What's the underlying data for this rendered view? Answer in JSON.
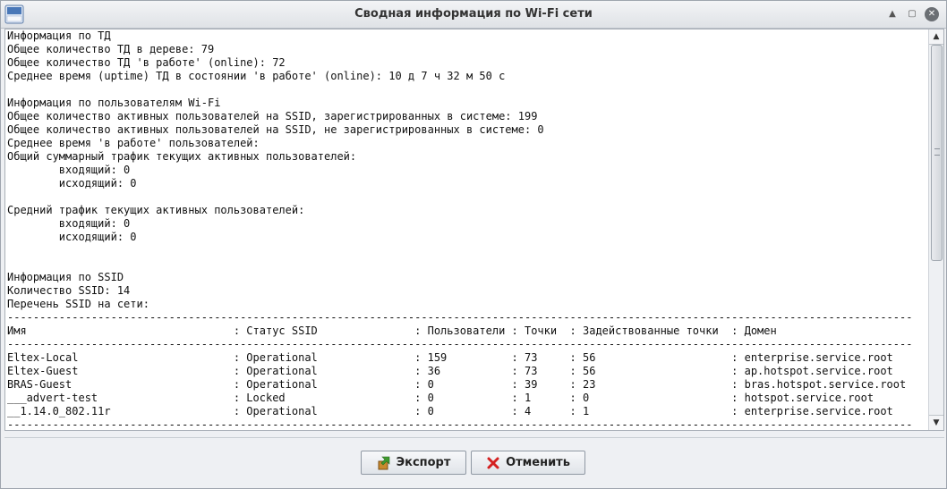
{
  "window": {
    "title": "Сводная информация по Wi-Fi сети"
  },
  "report": {
    "lines": [
      "Информация по ТД",
      "Общее количество ТД в дереве: 79",
      "Общее количество ТД 'в работе' (online): 72",
      "Среднее время (uptime) ТД в состоянии 'в работе' (online): 10 д 7 ч 32 м 50 с",
      "",
      "Информация по пользователям Wi-Fi",
      "Общее количество активных пользователей на SSID, зарегистрированных в системе: 199",
      "Общее количество активных пользователей на SSID, не зарегистрированных в системе: 0",
      "Среднее время 'в работе' пользователей:",
      "Общий суммарный трафик текущих активных пользователей:",
      "        входящий: 0",
      "        исходящий: 0",
      "",
      "Средний трафик текущих активных пользователей:",
      "        входящий: 0",
      "        исходящий: 0",
      "",
      "",
      "Информация по SSID",
      "Количество SSID: 14",
      "Перечень SSID на сети:",
      "--------------------------------------------------------------------------------------------------------------------------------------------",
      "Имя                                : Статус SSID               : Пользователи : Точки  : Задействованные точки  : Домен",
      "--------------------------------------------------------------------------------------------------------------------------------------------",
      "Eltex-Local                        : Operational               : 159          : 73     : 56                     : enterprise.service.root",
      "Eltex-Guest                        : Operational               : 36           : 73     : 56                     : ap.hotspot.service.root",
      "BRAS-Guest                         : Operational               : 0            : 39     : 23                     : bras.hotspot.service.root",
      "___advert-test                     : Locked                    : 0            : 1      : 0                      : hotspot.service.root",
      "__1.14.0_802.11r                   : Operational               : 0            : 4      : 1                      : enterprise.service.root",
      "--------------------------------------------------------------------------------------------------------------------------------------------"
    ]
  },
  "buttons": {
    "export": "Экспорт",
    "cancel": "Отменить"
  },
  "icons": {
    "app": "ems-app-icon",
    "export": "export-arrow-icon",
    "cancel": "red-x-icon"
  }
}
